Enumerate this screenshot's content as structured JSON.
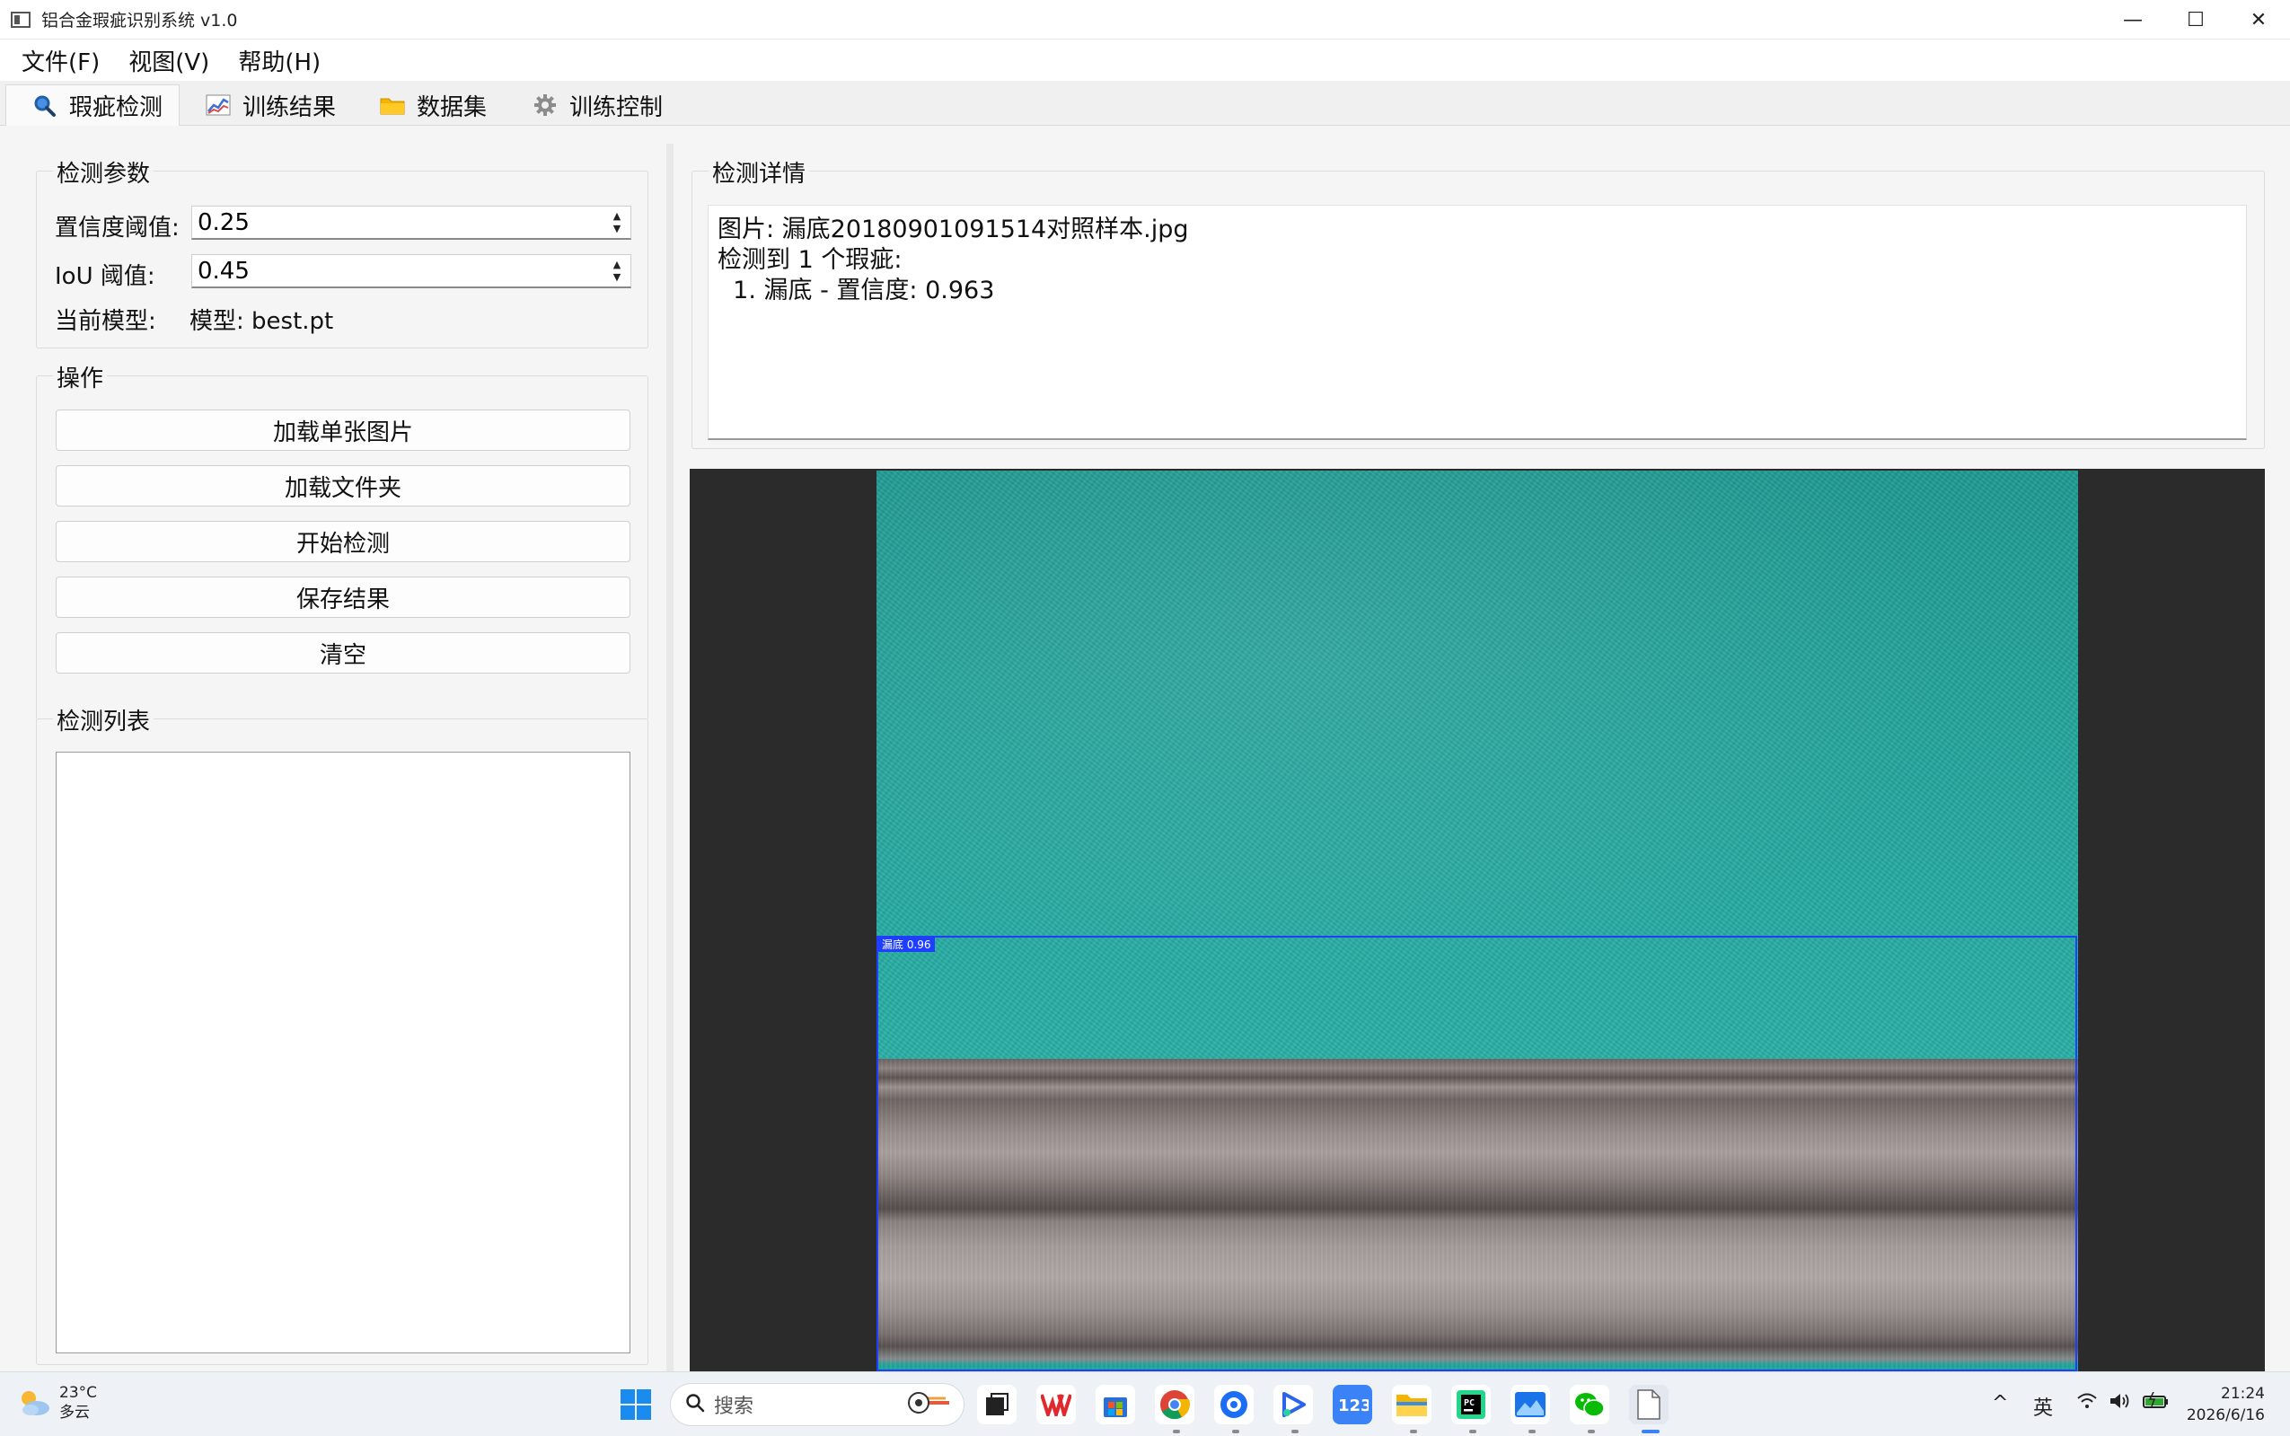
{
  "window": {
    "title": "铝合金瑕疵识别系统 v1.0",
    "controls": {
      "minimize": "—",
      "maximize": "☐",
      "close": "✕"
    }
  },
  "menu": [
    "文件(F)",
    "视图(V)",
    "帮助(H)"
  ],
  "tabs": [
    {
      "label": "瑕疵检测",
      "icon": "magnifier-icon",
      "active": true
    },
    {
      "label": "训练结果",
      "icon": "chart-icon",
      "active": false
    },
    {
      "label": "数据集",
      "icon": "folder-icon",
      "active": false
    },
    {
      "label": "训练控制",
      "icon": "gear-icon",
      "active": false
    }
  ],
  "params": {
    "title": "检测参数",
    "confidence_label": "置信度阈值:",
    "confidence_value": "0.25",
    "iou_label": "IoU 阈值:",
    "iou_value": "0.45",
    "model_label": "当前模型:",
    "model_value": "模型: best.pt"
  },
  "actions": {
    "title": "操作",
    "load_image": "加载单张图片",
    "load_folder": "加载文件夹",
    "start_detect": "开始检测",
    "save_result": "保存结果",
    "clear": "清空"
  },
  "detection_list": {
    "title": "检测列表"
  },
  "details": {
    "title": "检测详情",
    "lines": [
      "图片: 漏底20180901091514对照样本.jpg",
      "检测到 1 个瑕疵:",
      "  1. 漏底 - 置信度: 0.963"
    ]
  },
  "viewer": {
    "bbox_label": "漏底 0.96",
    "bbox_color": "#1e3fff"
  },
  "taskbar": {
    "weather_temp": "23°C",
    "weather_desc": "多云",
    "search_placeholder": "搜索",
    "input_method": "英",
    "time": "21:24",
    "date": "2026/6/16"
  }
}
